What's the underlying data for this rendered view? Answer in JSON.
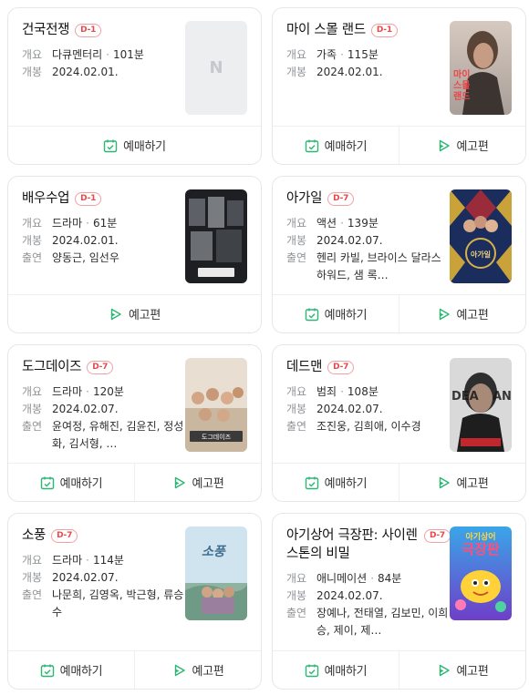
{
  "labels": {
    "overview": "개요",
    "release": "개봉",
    "cast": "출연",
    "book": "예매하기",
    "trailer": "예고편",
    "sep": "·"
  },
  "colors": {
    "badge": "#e8484a",
    "icon_green": "#2bb673"
  },
  "movies": [
    {
      "title": "건국전쟁",
      "badge": "D-1",
      "genre": "다큐멘터리",
      "runtime": "101분",
      "date": "2024.02.01.",
      "cast": "",
      "poster": "placeholder",
      "poster_mark": "N"
    },
    {
      "title": "마이 스몰 랜드",
      "badge": "D-1",
      "genre": "가족",
      "runtime": "115분",
      "date": "2024.02.01.",
      "cast": "",
      "poster": "my-small-land"
    },
    {
      "title": "배우수업",
      "badge": "D-1",
      "genre": "드라마",
      "runtime": "61분",
      "date": "2024.02.01.",
      "cast": "양동근, 임선우",
      "poster": "actor-class"
    },
    {
      "title": "아가일",
      "badge": "D-7",
      "genre": "액션",
      "runtime": "139분",
      "date": "2024.02.07.",
      "cast": "헨리 카빌, 브라이스 달라스 하워드, 샘 록…",
      "poster": "argylle"
    },
    {
      "title": "도그데이즈",
      "badge": "D-7",
      "genre": "드라마",
      "runtime": "120분",
      "date": "2024.02.07.",
      "cast": "윤여정, 유해진, 김윤진, 정성화, 김서형, …",
      "poster": "dog-days"
    },
    {
      "title": "데드맨",
      "badge": "D-7",
      "genre": "범죄",
      "runtime": "108분",
      "date": "2024.02.07.",
      "cast": "조진웅, 김희애, 이수경",
      "poster": "deadman"
    },
    {
      "title": "소풍",
      "badge": "D-7",
      "genre": "드라마",
      "runtime": "114분",
      "date": "2024.02.07.",
      "cast": "나문희, 김영옥, 박근형, 류승수",
      "poster": "picnic"
    },
    {
      "title": "아기상어 극장판: 사이렌 스톤의 비밀",
      "badge": "D-7",
      "genre": "애니메이션",
      "runtime": "84분",
      "date": "2024.02.07.",
      "cast": "장예나, 전태열, 김보민, 이희승, 제이, 제…",
      "poster": "baby-shark"
    }
  ]
}
